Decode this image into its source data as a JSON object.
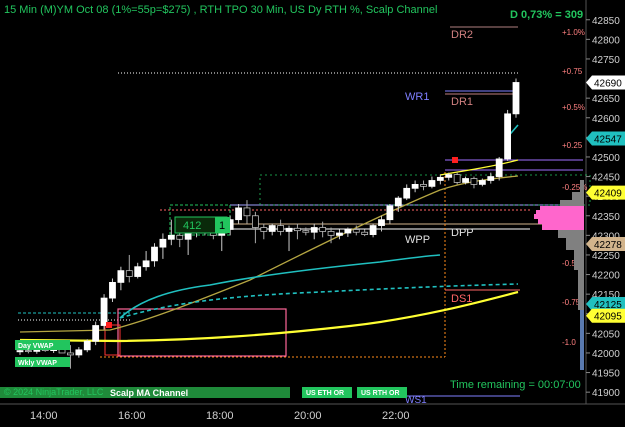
{
  "header": {
    "title": "15 Min (M)YM Oct 08 (1%=55p=$275) , RTH TPO 30 Min, US Dy RTH %, Scalp Channel",
    "delta": "D 0,73% = 309"
  },
  "price_axis": {
    "ticks": [
      "42850",
      "42800",
      "42750",
      "42650",
      "42600",
      "42550",
      "42500",
      "42450",
      "42400",
      "42350",
      "42300",
      "42250",
      "42200",
      "42150",
      "42100",
      "42050",
      "42000",
      "41950",
      "41900"
    ]
  },
  "price_tags": [
    {
      "label": "42690",
      "value": 42690,
      "bg": "#ffffff",
      "fg": "#000000"
    },
    {
      "label": "42547",
      "value": 42547,
      "bg": "#20c0c0",
      "fg": "#000000"
    },
    {
      "label": "42409",
      "value": 42409,
      "bg": "#ffff33",
      "fg": "#000000"
    },
    {
      "label": "42278",
      "value": 42278,
      "bg": "#d2b48c",
      "fg": "#000000"
    },
    {
      "label": "42125",
      "value": 42125,
      "bg": "#20c0c0",
      "fg": "#000000"
    },
    {
      "label": "42095",
      "value": 42095,
      "bg": "#ffff33",
      "fg": "#000000"
    }
  ],
  "percent_labels": [
    "+1.0%",
    "+0.75",
    "+0.5%",
    "+0.25",
    "-0.25%",
    "-0.5%",
    "-0.75",
    "-1.0"
  ],
  "level_labels": {
    "dr2": "DR2",
    "dr1": "DR1",
    "wr1": "WR1",
    "wpp": "WPP",
    "dpp": "DPP",
    "ds1": "DS1",
    "ws1": "WS1"
  },
  "box_label": {
    "value": "412",
    "count": "1"
  },
  "time_axis": [
    "14:00",
    "16:00",
    "18:00",
    "20:00",
    "22:00"
  ],
  "footer": {
    "copyright": "© 2024 NinjaTrader, LLC",
    "time_remaining": "Time remaining = 00:07:00"
  },
  "buttons": {
    "day_vwap": "Day VWAP",
    "wkly_vwap": "Wkly VWAP",
    "scalp_ma": "Scalp MA Channel",
    "us_eth": "US ETH OR",
    "us_rth": "US RTH OR"
  },
  "colors": {
    "background": "#000000",
    "up_candle": "#ffffff",
    "accent_green": "#22c55e",
    "vwap_yellow": "#ffff33",
    "vwap_cyan": "#20c0c0",
    "pivot_pink": "#ff6666",
    "wr_purple": "#7f7fff"
  },
  "chart_data": {
    "type": "candlestick",
    "y_range": [
      41880,
      42880
    ],
    "x_labels": [
      "14:00",
      "16:00",
      "18:00",
      "20:00",
      "22:00"
    ],
    "candles": [
      [
        42003,
        42010,
        41995,
        42006
      ],
      [
        42006,
        42012,
        41999,
        42004
      ],
      [
        42004,
        42012,
        41998,
        42010
      ],
      [
        42010,
        42016,
        42003,
        42006
      ],
      [
        42006,
        42015,
        42000,
        42012
      ],
      [
        42012,
        42020,
        42004,
        42000
      ],
      [
        42000,
        42020,
        41960,
        41995
      ],
      [
        41995,
        42015,
        41988,
        42008
      ],
      [
        42008,
        42035,
        42002,
        42030
      ],
      [
        42030,
        42080,
        42020,
        42070
      ],
      [
        42070,
        42150,
        42060,
        42140
      ],
      [
        42140,
        42190,
        42130,
        42180
      ],
      [
        42180,
        42220,
        42160,
        42210
      ],
      [
        42210,
        42250,
        42180,
        42195
      ],
      [
        42195,
        42230,
        42190,
        42220
      ],
      [
        42220,
        42260,
        42210,
        42235
      ],
      [
        42235,
        42280,
        42220,
        42270
      ],
      [
        42270,
        42305,
        42240,
        42290
      ],
      [
        42290,
        42340,
        42275,
        42300
      ],
      [
        42300,
        42330,
        42270,
        42290
      ],
      [
        42290,
        42320,
        42250,
        42310
      ],
      [
        42310,
        42340,
        42295,
        42325
      ],
      [
        42325,
        42345,
        42300,
        42320
      ],
      [
        42320,
        42340,
        42290,
        42300
      ],
      [
        42300,
        42325,
        42260,
        42315
      ],
      [
        42315,
        42350,
        42300,
        42340
      ],
      [
        42340,
        42380,
        42330,
        42370
      ],
      [
        42370,
        42390,
        42330,
        42350
      ],
      [
        42350,
        42360,
        42280,
        42320
      ],
      [
        42320,
        42330,
        42290,
        42310
      ],
      [
        42310,
        42330,
        42300,
        42325
      ],
      [
        42325,
        42340,
        42300,
        42310
      ],
      [
        42310,
        42325,
        42260,
        42318
      ],
      [
        42318,
        42330,
        42290,
        42312
      ],
      [
        42312,
        42320,
        42300,
        42308
      ],
      [
        42308,
        42330,
        42290,
        42320
      ],
      [
        42320,
        42335,
        42295,
        42310
      ],
      [
        42310,
        42320,
        42280,
        42300
      ],
      [
        42300,
        42315,
        42290,
        42306
      ],
      [
        42306,
        42320,
        42296,
        42315
      ],
      [
        42315,
        42325,
        42300,
        42308
      ],
      [
        42308,
        42315,
        42298,
        42302
      ],
      [
        42302,
        42330,
        42295,
        42325
      ],
      [
        42325,
        42350,
        42310,
        42340
      ],
      [
        42340,
        42380,
        42330,
        42375
      ],
      [
        42375,
        42400,
        42360,
        42395
      ],
      [
        42395,
        42430,
        42390,
        42420
      ],
      [
        42420,
        42440,
        42410,
        42430
      ],
      [
        42430,
        42440,
        42415,
        42425
      ],
      [
        42425,
        42450,
        42420,
        42440
      ],
      [
        42440,
        42455,
        42430,
        42448
      ],
      [
        42448,
        42460,
        42440,
        42455
      ],
      [
        42455,
        42460,
        42430,
        42435
      ],
      [
        42435,
        42450,
        42430,
        42445
      ],
      [
        42445,
        42450,
        42420,
        42430
      ],
      [
        42430,
        42445,
        42425,
        42440
      ],
      [
        42440,
        42460,
        42432,
        42450
      ],
      [
        42450,
        42500,
        42440,
        42495
      ],
      [
        42495,
        42620,
        42490,
        42610
      ],
      [
        42610,
        42700,
        42600,
        42690
      ]
    ]
  }
}
